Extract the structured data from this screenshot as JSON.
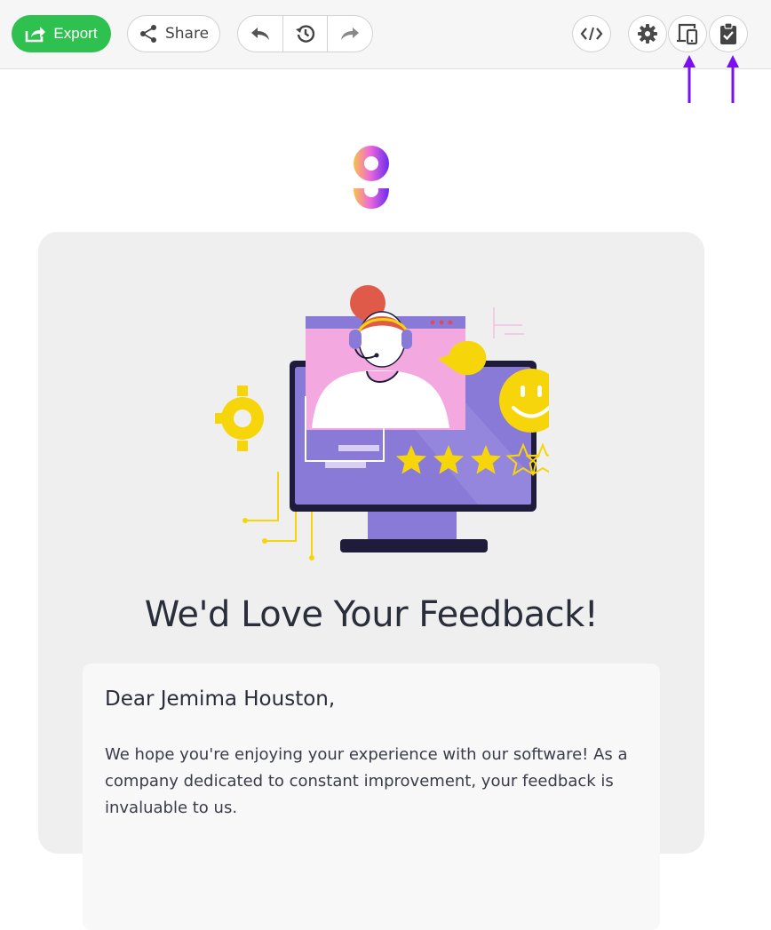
{
  "toolbar": {
    "export_label": "Export",
    "share_label": "Share",
    "icons": {
      "undo": "undo-icon",
      "history": "history-icon",
      "redo": "redo-icon",
      "code": "code-icon",
      "settings": "gear-icon",
      "responsive": "responsive-preview-icon",
      "clipboard": "clipboard-check-icon"
    }
  },
  "colors": {
    "export_green": "#2fc14f",
    "annotation_arrow": "#7a10f0",
    "card_bg": "#efefef",
    "heading": "#2a2d3a"
  },
  "email": {
    "headline": "We'd Love Your Feedback!",
    "greeting": "Dear Jemima Houston,",
    "body": "We hope you're enjoying your experience with our software! As a company dedicated to constant improvement, your feedback is invaluable to us.",
    "rating_shown": "3 of 5 stars"
  }
}
